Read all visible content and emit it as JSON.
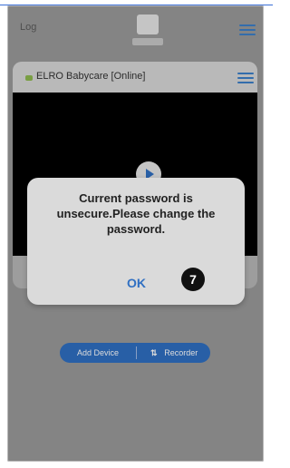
{
  "header": {
    "log_label": "Log",
    "logo_icon": "monitor-icon",
    "menu_icon": "menu-icon"
  },
  "device": {
    "name": "ELRO Babycare [Online]",
    "status_color": "#8db84e",
    "settings_icon": "settings-icon"
  },
  "dialog": {
    "message": "Current password is unsecure.Please change the password.",
    "ok_label": "OK",
    "step_badge": "7"
  },
  "actions": {
    "left_label": "Add Device",
    "right_label": "Recorder",
    "right_icon": "split-icon",
    "accent_color": "#2f6fc2"
  }
}
